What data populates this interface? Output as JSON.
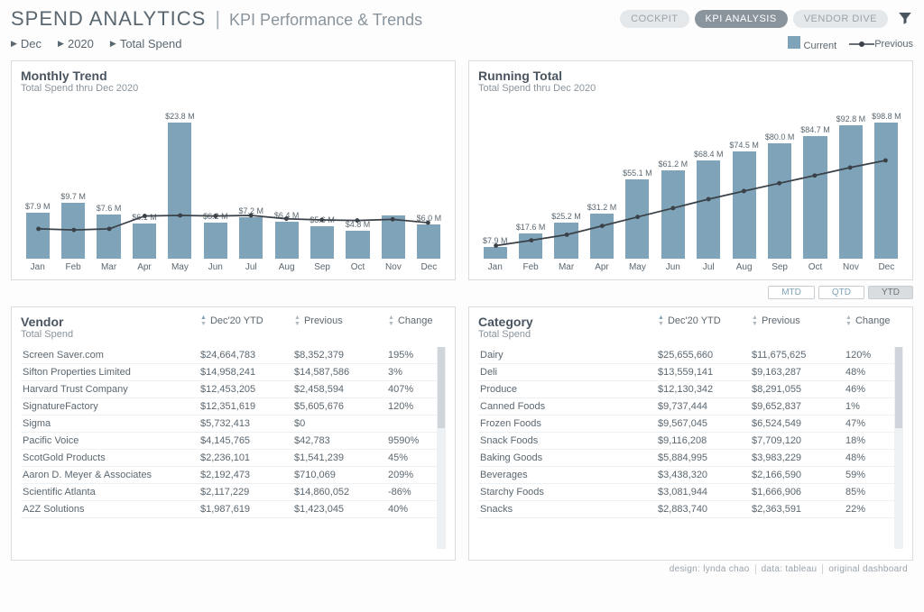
{
  "header": {
    "title": "SPEND ANALYTICS",
    "subtitle": "KPI Performance & Trends",
    "tabs": {
      "cockpit": "COCKPIT",
      "kpi": "KPI ANALYSIS",
      "vendor": "VENDOR DIVE"
    },
    "selectors": {
      "month": "Dec",
      "year": "2020",
      "metric": "Total Spend"
    },
    "legend": {
      "current": "Current",
      "previous": "Previous"
    }
  },
  "chart_data": [
    {
      "type": "bar",
      "title": "Monthly Trend",
      "subtitle": "Total Spend thru Dec 2020",
      "categories": [
        "Jan",
        "Feb",
        "Mar",
        "Apr",
        "May",
        "Jun",
        "Jul",
        "Aug",
        "Sep",
        "Oct",
        "Nov",
        "Dec"
      ],
      "series": [
        {
          "name": "Current",
          "values": [
            7.9,
            9.7,
            7.6,
            6.1,
            23.8,
            6.2,
            7.2,
            6.4,
            5.6,
            4.8,
            7.5,
            6.0
          ],
          "labels": [
            "$7.9 M",
            "$9.7 M",
            "$7.6 M",
            "$6.1 M",
            "$23.8 M",
            "$6.2 M",
            "$7.2 M",
            "$6.4 M",
            "$5.6 M",
            "$4.8 M",
            "",
            "$6.0 M"
          ]
        },
        {
          "name": "Previous",
          "values": [
            4.0,
            3.8,
            4.0,
            6.3,
            6.4,
            6.3,
            6.4,
            5.8,
            5.6,
            5.5,
            5.7,
            5.1
          ]
        }
      ],
      "ylim": [
        0,
        25
      ]
    },
    {
      "type": "bar",
      "title": "Running Total",
      "subtitle": "Total Spend thru Dec 2020",
      "categories": [
        "Jan",
        "Feb",
        "Mar",
        "Apr",
        "May",
        "Jun",
        "Jul",
        "Aug",
        "Sep",
        "Oct",
        "Nov",
        "Dec"
      ],
      "series": [
        {
          "name": "Current",
          "values": [
            7.9,
            17.6,
            25.2,
            31.2,
            55.1,
            61.2,
            68.4,
            74.5,
            80.0,
            84.7,
            92.8,
            98.8
          ],
          "labels": [
            "$7.9 M",
            "$17.6 M",
            "$25.2 M",
            "$31.2 M",
            "$55.1 M",
            "$61.2 M",
            "$68.4 M",
            "$74.5 M",
            "$80.0 M",
            "$84.7 M",
            "$92.8 M",
            "$98.8 M"
          ]
        },
        {
          "name": "Previous",
          "values": [
            4.0,
            7.8,
            11.8,
            18.1,
            24.5,
            30.8,
            37.2,
            43.0,
            48.6,
            54.1,
            59.8,
            64.9
          ]
        }
      ],
      "ylim": [
        0,
        100
      ]
    }
  ],
  "periods": {
    "mtd": "MTD",
    "qtd": "QTD",
    "ytd": "YTD"
  },
  "vendor_table": {
    "title": "Vendor",
    "subtitle": "Total Spend",
    "columns": {
      "ytd": "Dec'20 YTD",
      "prev": "Previous",
      "chg": "Change"
    },
    "rows": [
      {
        "name": "Screen Saver.com",
        "ytd": "$24,664,783",
        "prev": "$8,352,379",
        "chg": "195%"
      },
      {
        "name": "Sifton Properties Limited",
        "ytd": "$14,958,241",
        "prev": "$14,587,586",
        "chg": "3%"
      },
      {
        "name": "Harvard Trust Company",
        "ytd": "$12,453,205",
        "prev": "$2,458,594",
        "chg": "407%"
      },
      {
        "name": "SignatureFactory",
        "ytd": "$12,351,619",
        "prev": "$5,605,676",
        "chg": "120%"
      },
      {
        "name": "Sigma",
        "ytd": "$5,732,413",
        "prev": "$0",
        "chg": ""
      },
      {
        "name": "Pacific Voice",
        "ytd": "$4,145,765",
        "prev": "$42,783",
        "chg": "9590%"
      },
      {
        "name": "ScotGold Products",
        "ytd": "$2,236,101",
        "prev": "$1,541,239",
        "chg": "45%"
      },
      {
        "name": "Aaron D. Meyer & Associates",
        "ytd": "$2,192,473",
        "prev": "$710,069",
        "chg": "209%"
      },
      {
        "name": "Scientific Atlanta",
        "ytd": "$2,117,229",
        "prev": "$14,860,052",
        "chg": "-86%"
      },
      {
        "name": "A2Z Solutions",
        "ytd": "$1,987,619",
        "prev": "$1,423,045",
        "chg": "40%"
      }
    ]
  },
  "category_table": {
    "title": "Category",
    "subtitle": "Total Spend",
    "columns": {
      "ytd": "Dec'20 YTD",
      "prev": "Previous",
      "chg": "Change"
    },
    "rows": [
      {
        "name": "Dairy",
        "ytd": "$25,655,660",
        "prev": "$11,675,625",
        "chg": "120%"
      },
      {
        "name": "Deli",
        "ytd": "$13,559,141",
        "prev": "$9,163,287",
        "chg": "48%"
      },
      {
        "name": "Produce",
        "ytd": "$12,130,342",
        "prev": "$8,291,055",
        "chg": "46%"
      },
      {
        "name": "Canned Foods",
        "ytd": "$9,737,444",
        "prev": "$9,652,837",
        "chg": "1%"
      },
      {
        "name": "Frozen Foods",
        "ytd": "$9,567,045",
        "prev": "$6,524,549",
        "chg": "47%"
      },
      {
        "name": "Snack Foods",
        "ytd": "$9,116,208",
        "prev": "$7,709,120",
        "chg": "18%"
      },
      {
        "name": "Baking Goods",
        "ytd": "$5,884,995",
        "prev": "$3,983,229",
        "chg": "48%"
      },
      {
        "name": "Beverages",
        "ytd": "$3,438,320",
        "prev": "$2,166,590",
        "chg": "59%"
      },
      {
        "name": "Starchy Foods",
        "ytd": "$3,081,944",
        "prev": "$1,666,906",
        "chg": "85%"
      },
      {
        "name": "Snacks",
        "ytd": "$2,883,740",
        "prev": "$2,363,591",
        "chg": "22%"
      }
    ]
  },
  "footer": {
    "design": "design: lynda chao",
    "data": "data: tableau",
    "orig": "original dashboard"
  }
}
